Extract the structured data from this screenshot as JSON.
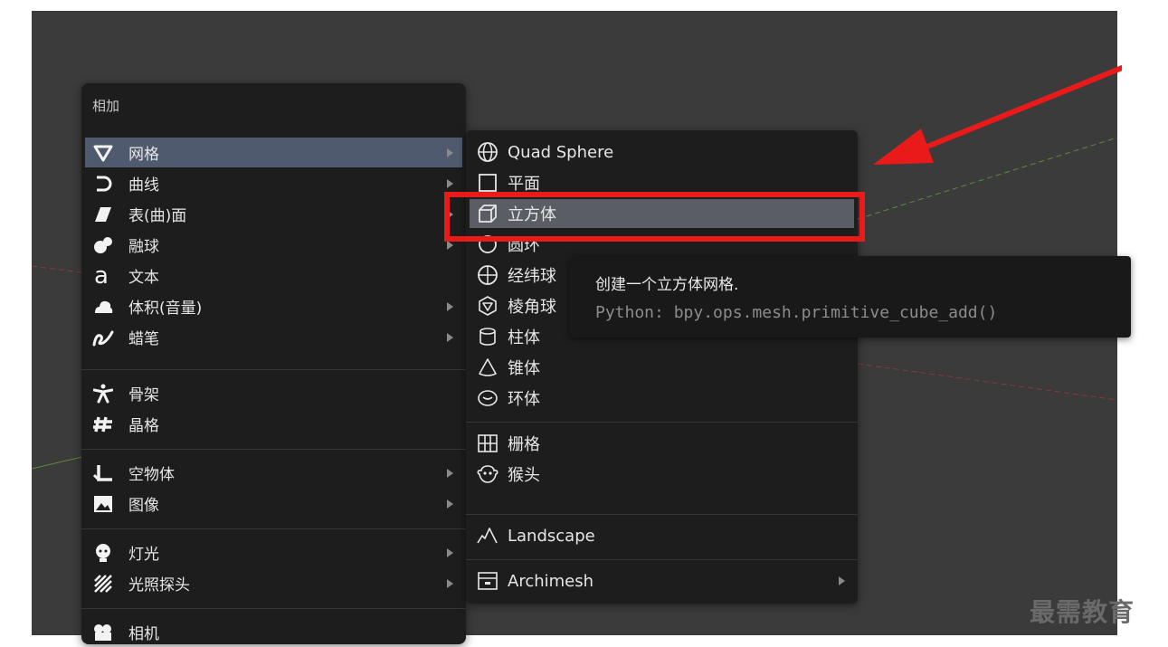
{
  "main_menu": {
    "title": "相加",
    "items": [
      {
        "label": "网格",
        "icon": "mesh-icon",
        "has_submenu": true,
        "active": true
      },
      {
        "label": "曲线",
        "icon": "curve-icon",
        "has_submenu": true
      },
      {
        "label": "表(曲)面",
        "icon": "surface-icon",
        "has_submenu": true
      },
      {
        "label": "融球",
        "icon": "metaball-icon",
        "has_submenu": true
      },
      {
        "label": "文本",
        "icon": "text-icon",
        "has_submenu": false
      },
      {
        "label": "体积(音量)",
        "icon": "volume-icon",
        "has_submenu": true
      },
      {
        "label": "蜡笔",
        "icon": "grease-pencil-icon",
        "has_submenu": true
      },
      {
        "label": "骨架",
        "icon": "armature-icon",
        "has_submenu": false
      },
      {
        "label": "晶格",
        "icon": "lattice-icon",
        "has_submenu": false
      },
      {
        "label": "空物体",
        "icon": "empty-icon",
        "has_submenu": true
      },
      {
        "label": "图像",
        "icon": "image-icon",
        "has_submenu": true
      },
      {
        "label": "灯光",
        "icon": "light-icon",
        "has_submenu": true
      },
      {
        "label": "光照探头",
        "icon": "light-probe-icon",
        "has_submenu": true
      },
      {
        "label": "相机",
        "icon": "camera-icon",
        "has_submenu": false
      }
    ]
  },
  "mesh_submenu": {
    "items": [
      {
        "label": "Quad Sphere",
        "icon": "quad-sphere-icon"
      },
      {
        "label": "平面",
        "icon": "plane-icon"
      },
      {
        "label": "立方体",
        "icon": "cube-icon",
        "highlighted": true
      },
      {
        "label": "圆环",
        "icon": "circle-icon"
      },
      {
        "label": "经纬球",
        "icon": "uv-sphere-icon"
      },
      {
        "label": "棱角球",
        "icon": "ico-sphere-icon"
      },
      {
        "label": "柱体",
        "icon": "cylinder-icon"
      },
      {
        "label": "锥体",
        "icon": "cone-icon"
      },
      {
        "label": "环体",
        "icon": "torus-icon"
      },
      {
        "label": "栅格",
        "icon": "grid-icon"
      },
      {
        "label": "猴头",
        "icon": "monkey-icon"
      },
      {
        "label": "Landscape",
        "icon": "landscape-icon"
      },
      {
        "label": "Archimesh",
        "icon": "archimesh-icon",
        "has_submenu": true
      }
    ]
  },
  "tooltip": {
    "title": "创建一个立方体网格.",
    "python": "Python: bpy.ops.mesh.primitive_cube_add()"
  },
  "watermark": "最需教育",
  "colors": {
    "viewport_bg": "#3b3b3b",
    "menu_bg": "#1d1d1d",
    "active_item": "#505a6e",
    "highlight_item": "#5a5d63",
    "annotation_red": "#e81a1a"
  }
}
